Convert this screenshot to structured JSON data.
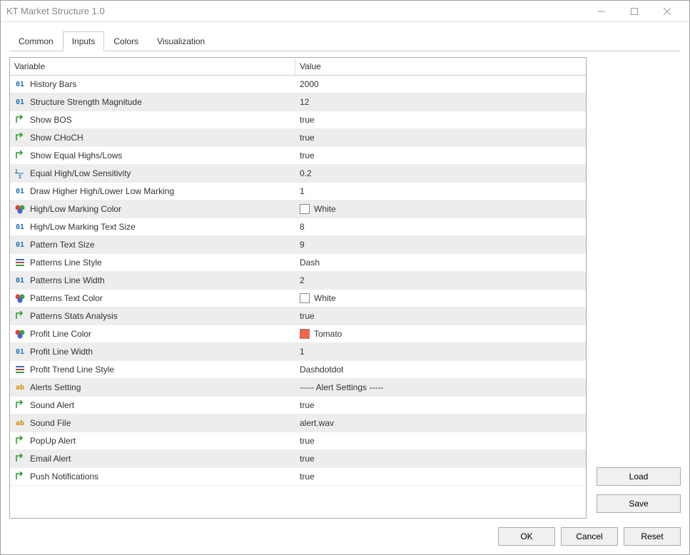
{
  "title": "KT Market Structure 1.0",
  "tabs": {
    "t0": "Common",
    "t1": "Inputs",
    "t2": "Colors",
    "t3": "Visualization"
  },
  "headers": {
    "variable": "Variable",
    "value": "Value"
  },
  "rows": [
    {
      "icon": "int",
      "name": "History Bars",
      "value": "2000"
    },
    {
      "icon": "int",
      "name": "Structure Strength Magnitude",
      "value": "12"
    },
    {
      "icon": "arrow",
      "name": "Show BOS",
      "value": "true"
    },
    {
      "icon": "arrow",
      "name": "Show CHoCH",
      "value": "true"
    },
    {
      "icon": "arrow",
      "name": "Show Equal Highs/Lows",
      "value": "true"
    },
    {
      "icon": "frac",
      "name": "Equal High/Low Sensitivity",
      "value": "0.2"
    },
    {
      "icon": "int",
      "name": "Draw Higher High/Lower Low Marking",
      "value": "1"
    },
    {
      "icon": "color",
      "name": "High/Low Marking Color",
      "value": "White",
      "swatch": "white"
    },
    {
      "icon": "int",
      "name": "High/Low Marking Text Size",
      "value": "8"
    },
    {
      "icon": "int",
      "name": "Pattern Text Size",
      "value": "9"
    },
    {
      "icon": "lines",
      "name": "Patterns Line Style",
      "value": "Dash"
    },
    {
      "icon": "int",
      "name": "Patterns Line Width",
      "value": "2"
    },
    {
      "icon": "color",
      "name": "Patterns Text Color",
      "value": "White",
      "swatch": "white"
    },
    {
      "icon": "arrow",
      "name": "Patterns Stats Analysis",
      "value": "true"
    },
    {
      "icon": "color",
      "name": "Profit Line Color",
      "value": "Tomato",
      "swatch": "tomato"
    },
    {
      "icon": "int",
      "name": "Profit Line Width",
      "value": "1"
    },
    {
      "icon": "lines",
      "name": "Profit Trend Line Style",
      "value": "Dashdotdot"
    },
    {
      "icon": "ab",
      "name": "Alerts Setting",
      "value": "----- Alert Settings -----"
    },
    {
      "icon": "arrow",
      "name": "Sound Alert",
      "value": "true"
    },
    {
      "icon": "ab",
      "name": "Sound File",
      "value": "alert.wav"
    },
    {
      "icon": "arrow",
      "name": "PopUp Alert",
      "value": "true"
    },
    {
      "icon": "arrow",
      "name": "Email Alert",
      "value": "true"
    },
    {
      "icon": "arrow",
      "name": "Push Notifications",
      "value": "true"
    }
  ],
  "side": {
    "load": "Load",
    "save": "Save"
  },
  "footer": {
    "ok": "OK",
    "cancel": "Cancel",
    "reset": "Reset"
  }
}
